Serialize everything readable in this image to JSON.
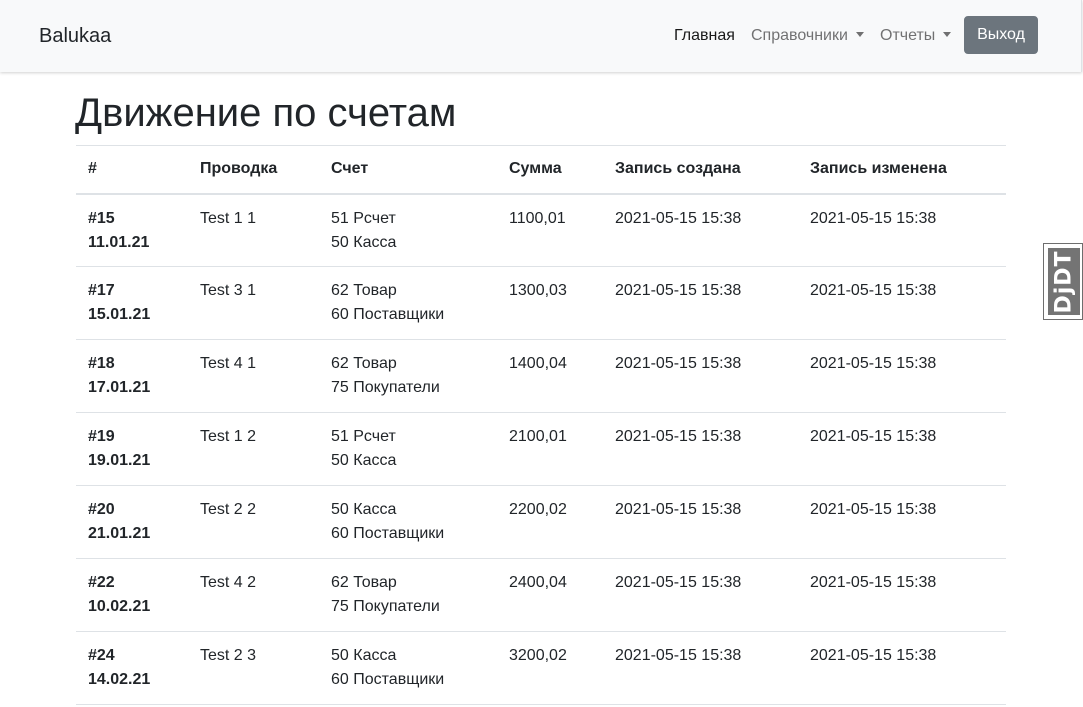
{
  "navbar": {
    "brand": "Balukaa",
    "items": [
      {
        "label": "Главная",
        "active": true
      },
      {
        "label": "Справочники",
        "dropdown": true
      },
      {
        "label": "Отчеты",
        "dropdown": true
      }
    ],
    "logout_label": "Выход"
  },
  "page": {
    "title": "Движение по счетам"
  },
  "table": {
    "headers": [
      "#",
      "Проводка",
      "Счет",
      "Сумма",
      "Запись создана",
      "Запись изменена"
    ],
    "rows": [
      {
        "id": "#15",
        "date": "11.01.21",
        "posting": "Test 1 1",
        "debit": "51 Рсчет",
        "credit": "50 Касса",
        "amount": "1100,01",
        "created": "2021-05-15 15:38",
        "modified": "2021-05-15 15:38"
      },
      {
        "id": "#17",
        "date": "15.01.21",
        "posting": "Test 3 1",
        "debit": "62 Товар",
        "credit": "60 Поставщики",
        "amount": "1300,03",
        "created": "2021-05-15 15:38",
        "modified": "2021-05-15 15:38"
      },
      {
        "id": "#18",
        "date": "17.01.21",
        "posting": "Test 4 1",
        "debit": "62 Товар",
        "credit": "75 Покупатели",
        "amount": "1400,04",
        "created": "2021-05-15 15:38",
        "modified": "2021-05-15 15:38"
      },
      {
        "id": "#19",
        "date": "19.01.21",
        "posting": "Test 1 2",
        "debit": "51 Рсчет",
        "credit": "50 Касса",
        "amount": "2100,01",
        "created": "2021-05-15 15:38",
        "modified": "2021-05-15 15:38"
      },
      {
        "id": "#20",
        "date": "21.01.21",
        "posting": "Test 2 2",
        "debit": "50 Касса",
        "credit": "60 Поставщики",
        "amount": "2200,02",
        "created": "2021-05-15 15:38",
        "modified": "2021-05-15 15:38"
      },
      {
        "id": "#22",
        "date": "10.02.21",
        "posting": "Test 4 2",
        "debit": "62 Товар",
        "credit": "75 Покупатели",
        "amount": "2400,04",
        "created": "2021-05-15 15:38",
        "modified": "2021-05-15 15:38"
      },
      {
        "id": "#24",
        "date": "14.02.21",
        "posting": "Test 2 3",
        "debit": "50 Касса",
        "credit": "60 Поставщики",
        "amount": "3200,02",
        "created": "2021-05-15 15:38",
        "modified": "2021-05-15 15:38"
      }
    ]
  },
  "debug_toolbar": {
    "handle_text": "DjDT",
    "icon": "django-debug-toolbar-handle"
  },
  "colors": {
    "navbar_bg": "#f8f9fa",
    "logout_button_bg": "#6c757d",
    "table_border": "#dee2e6",
    "text": "#212529"
  }
}
